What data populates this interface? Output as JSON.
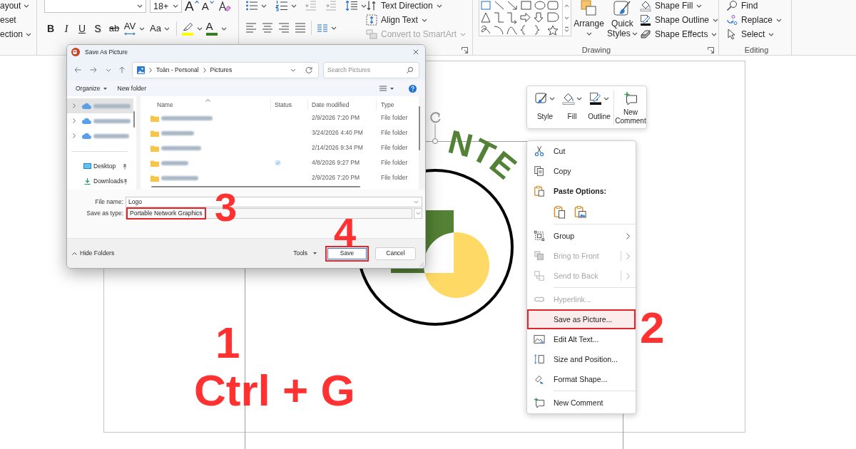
{
  "ribbon": {
    "layout_group": [
      {
        "label": "ayout",
        "has_menu": true
      },
      {
        "label": "eset",
        "has_menu": false
      },
      {
        "label": "ection",
        "has_menu": true
      }
    ],
    "font_group": {
      "font_size": "18+",
      "size_buttons": [
        {
          "kind": "grow",
          "label": "A"
        },
        {
          "kind": "shrink",
          "label": "A"
        }
      ],
      "format_buttons": [
        {
          "kind": "bold",
          "label": "B",
          "has_menu": false
        },
        {
          "kind": "italic",
          "label": "I",
          "has_menu": false
        },
        {
          "kind": "underline",
          "label": "U",
          "has_menu": false
        },
        {
          "kind": "shadow",
          "label": "S",
          "has_menu": false
        },
        {
          "kind": "strike",
          "label": "ab",
          "has_menu": false
        },
        {
          "kind": "spacing",
          "label": "AV",
          "has_menu": true
        },
        {
          "kind": "case",
          "label": "Aa",
          "has_menu": true
        }
      ],
      "color_buttons": [
        {
          "kind": "highlight",
          "color": "#ffff00",
          "has_menu": true
        },
        {
          "kind": "font_color",
          "label": "A",
          "color": "#3b7d23",
          "has_menu": true
        }
      ]
    },
    "paragraph_group": {
      "indent_buttons": [
        {
          "kind": "decrease",
          "disabled": true
        },
        {
          "kind": "increase",
          "disabled": true
        }
      ],
      "commands": [
        {
          "label": "Text Direction",
          "has_menu": true,
          "disabled": false
        },
        {
          "label": "Align Text",
          "has_menu": true,
          "disabled": false
        },
        {
          "label": "Convert to SmartArt",
          "has_menu": true,
          "disabled": true
        }
      ]
    },
    "drawing_group": {
      "label": "Drawing",
      "large_buttons": [
        {
          "label": "Arrange",
          "has_menu": true
        },
        {
          "label": "Quick Styles",
          "has_menu": true
        }
      ],
      "commands": [
        {
          "label": "Shape Fill",
          "has_menu": true
        },
        {
          "label": "Shape Outline",
          "has_menu": true
        },
        {
          "label": "Shape Effects",
          "has_menu": true
        }
      ]
    },
    "editing_group": {
      "label": "Editing",
      "commands": [
        {
          "label": "Find",
          "has_menu": false
        },
        {
          "label": "Replace",
          "has_menu": true
        },
        {
          "label": "Select",
          "has_menu": true
        }
      ]
    }
  },
  "dialog": {
    "title": "Save As Picture",
    "address": [
      "Toàn - Personal",
      "Pictures"
    ],
    "search": {
      "placeholder": "Search Pictures"
    },
    "toolbar": [
      {
        "label": "Organize",
        "has_menu": true
      },
      {
        "label": "New folder",
        "has_menu": false
      }
    ],
    "nav_pane": [
      {
        "kind": "blurred",
        "selected": true
      },
      {
        "kind": "blurred",
        "selected": false
      },
      {
        "kind": "blurred",
        "selected": false
      },
      {
        "kind": "quick",
        "label": "Desktop",
        "pinned": true,
        "selected": false
      },
      {
        "kind": "quick",
        "label": "Downloads",
        "pinned": true,
        "selected": false
      }
    ],
    "columns": [
      {
        "label": "Name",
        "sorted": true
      },
      {
        "label": "Status",
        "sorted": false
      },
      {
        "label": "Date modified",
        "sorted": false
      },
      {
        "label": "Type",
        "sorted": false
      }
    ],
    "files": [
      {
        "date": "2/9/2026 7:20 PM",
        "type": "File folder",
        "has_status": false
      },
      {
        "date": "3/24/2026 4:40 PM",
        "type": "File folder",
        "has_status": false
      },
      {
        "date": "2/14/2026 9:34 PM",
        "type": "File folder",
        "has_status": false
      },
      {
        "date": "4/8/2026 9:27 PM",
        "type": "File folder",
        "has_status": true
      },
      {
        "date": "2/9/2026 7:20 PM",
        "type": "File folder",
        "has_status": false
      }
    ],
    "file_name": {
      "label": "File name:",
      "value": "Logo"
    },
    "save_type": {
      "label": "Save as type:",
      "value": "Portable Network Graphics",
      "highlighted": true
    },
    "hide_folders": "Hide Folders",
    "tools": {
      "label": "Tools",
      "has_menu": true
    },
    "buttons": [
      {
        "label": "Save",
        "default": true,
        "highlighted": true
      },
      {
        "label": "Cancel",
        "default": false,
        "highlighted": false
      }
    ]
  },
  "slide": {
    "logo_text": "NTE"
  },
  "mini_toolbar": [
    {
      "label": "Style",
      "has_menu": true
    },
    {
      "label": "Fill",
      "has_menu": true
    },
    {
      "label": "Outline",
      "has_menu": true
    },
    {
      "label": "New Comment",
      "has_menu": false
    }
  ],
  "context_menu": [
    {
      "kind": "item",
      "label": "Cut",
      "disabled": false,
      "has_submenu": false,
      "highlighted": false
    },
    {
      "kind": "item",
      "label": "Copy",
      "disabled": false,
      "has_submenu": false,
      "highlighted": false
    },
    {
      "kind": "header",
      "label": "Paste Options:"
    },
    {
      "kind": "paste_row"
    },
    {
      "kind": "separator"
    },
    {
      "kind": "item",
      "label": "Group",
      "disabled": false,
      "has_submenu": true,
      "highlighted": false
    },
    {
      "kind": "item",
      "label": "Bring to Front",
      "disabled": true,
      "has_submenu": true,
      "highlighted": false
    },
    {
      "kind": "item",
      "label": "Send to Back",
      "disabled": true,
      "has_submenu": true,
      "highlighted": false
    },
    {
      "kind": "separator"
    },
    {
      "kind": "item",
      "label": "Hyperlink...",
      "disabled": true,
      "has_submenu": false,
      "highlighted": false
    },
    {
      "kind": "item",
      "label": "Save as Picture...",
      "disabled": false,
      "has_submenu": false,
      "highlighted": true
    },
    {
      "kind": "item",
      "label": "Edit Alt Text...",
      "disabled": false,
      "has_submenu": false,
      "highlighted": false
    },
    {
      "kind": "item",
      "label": "Size and Position...",
      "disabled": false,
      "has_submenu": false,
      "highlighted": false
    },
    {
      "kind": "item",
      "label": "Format Shape...",
      "disabled": false,
      "has_submenu": false,
      "highlighted": false
    },
    {
      "kind": "separator"
    },
    {
      "kind": "item",
      "label": "New Comment",
      "disabled": false,
      "has_submenu": false,
      "highlighted": false
    }
  ],
  "annotations": [
    {
      "label": "1"
    },
    {
      "label": "Ctrl + G"
    },
    {
      "label": "2"
    },
    {
      "label": "3"
    },
    {
      "label": "4"
    }
  ]
}
